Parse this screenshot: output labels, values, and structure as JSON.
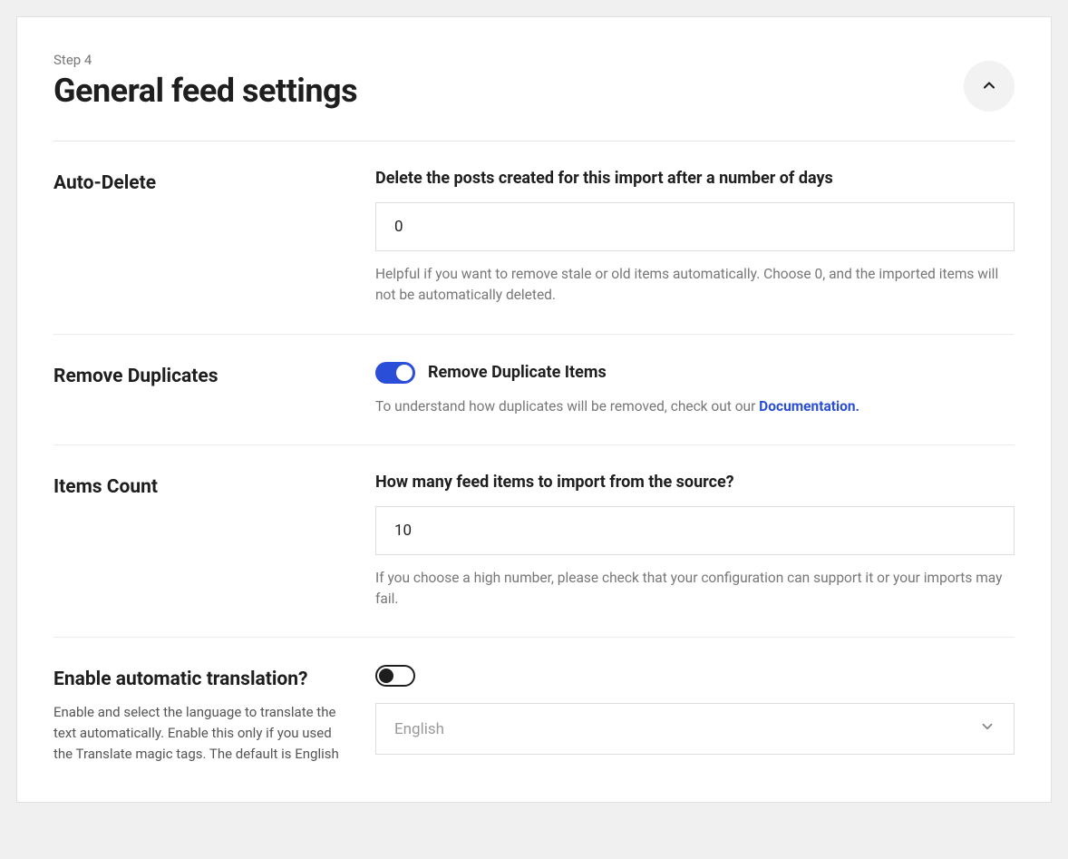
{
  "header": {
    "step_label": "Step 4",
    "title": "General feed settings"
  },
  "settings": {
    "auto_delete": {
      "label": "Auto-Delete",
      "field_heading": "Delete the posts created for this import after a number of days",
      "value": "0",
      "help": "Helpful if you want to remove stale or old items automatically. Choose 0, and the imported items will not be automatically deleted."
    },
    "remove_duplicates": {
      "label": "Remove Duplicates",
      "toggle_label": "Remove Duplicate Items",
      "help_prefix": "To understand how duplicates will be removed, check out our ",
      "help_link": "Documentation."
    },
    "items_count": {
      "label": "Items Count",
      "field_heading": "How many feed items to import from the source?",
      "value": "10",
      "help": "If you choose a high number, please check that your configuration can support it or your imports may fail."
    },
    "translation": {
      "label": "Enable automatic translation?",
      "sublabel": "Enable and select the language to translate the text automatically. Enable this only if you used the Translate magic tags. The default is English",
      "selected": "English"
    }
  }
}
